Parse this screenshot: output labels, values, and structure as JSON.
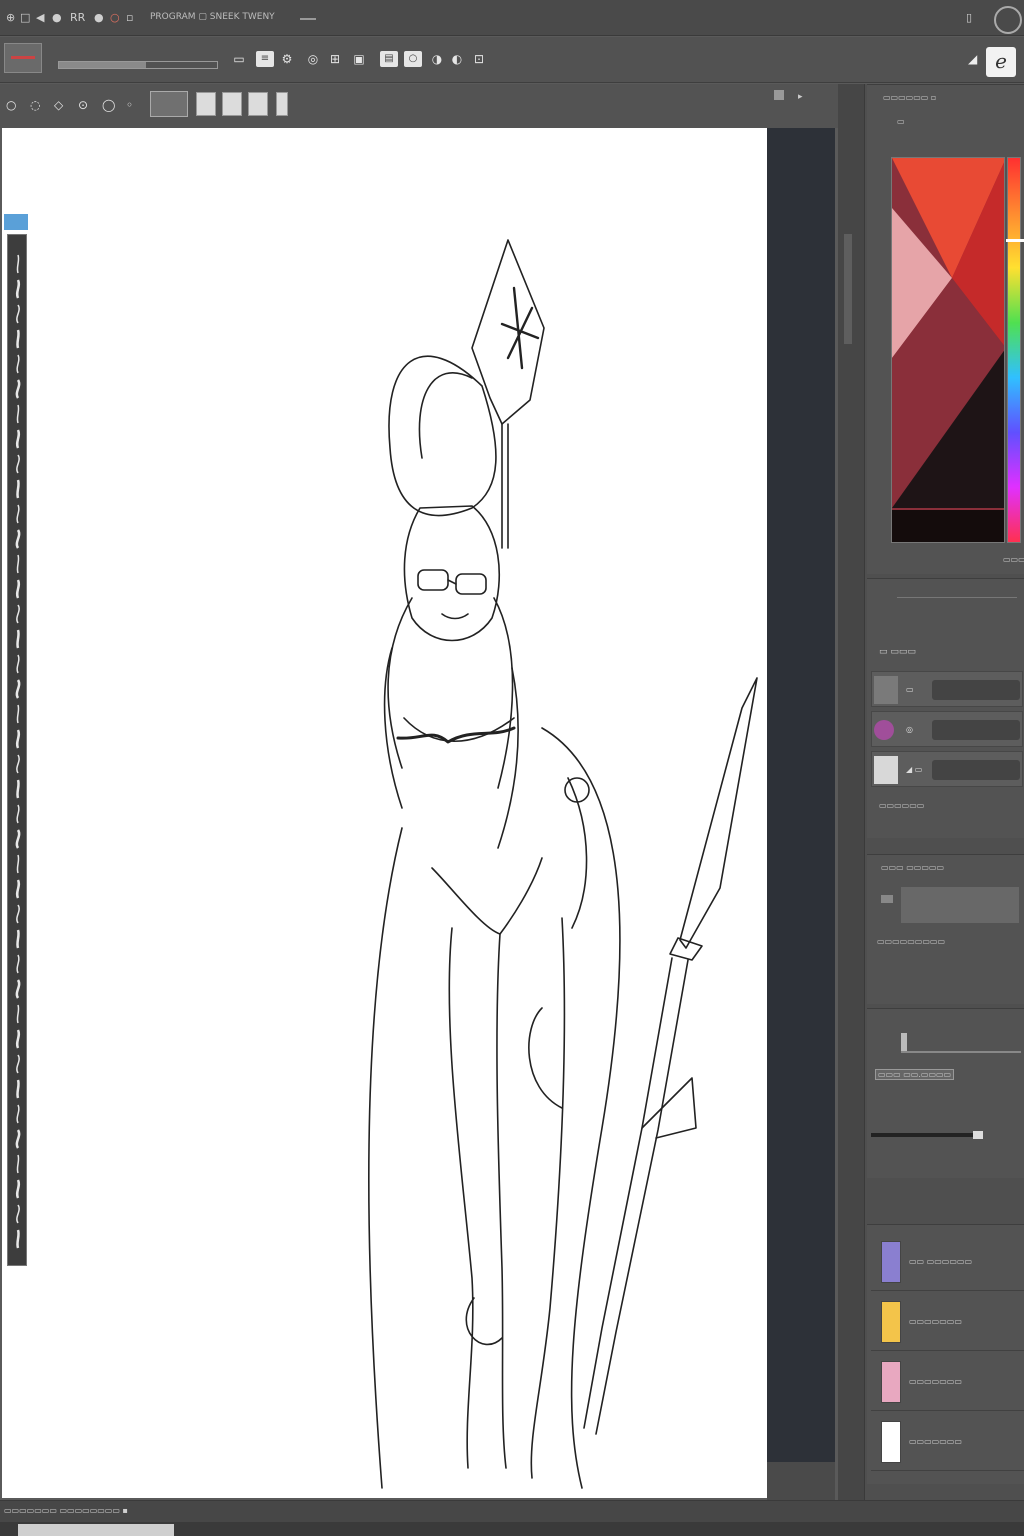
{
  "titlebar": {
    "menu_glyphs": [
      "⊕",
      "□",
      "◀",
      "●",
      "RR",
      "●",
      "○",
      "▫"
    ],
    "title": "PROGRAM ▢ SNEEK TWENY",
    "window_glyph": "▯"
  },
  "toolbar_primary": {
    "tools": [
      "▭",
      "≡",
      "⚙",
      "◎",
      "⊞",
      "▣",
      "▤",
      "○",
      "◑",
      "◐",
      "⊡"
    ],
    "file_progress": 0.55,
    "pen_icon": "◢",
    "logo": "e"
  },
  "toolbar_secondary": {
    "tools": [
      "○",
      "◌",
      "◇",
      "⊙",
      "◯",
      "◦"
    ],
    "panel_glyph": "▸"
  },
  "canvas": {
    "background": "#ffffff"
  },
  "color_panel": {
    "header": "▭▭▭▭▭▭ ▫",
    "sub": "▭",
    "gradient_top": "#e84a34",
    "gradient_mid": "#8a2f3a",
    "gradient_dark": "#1e1416",
    "hue_marker": 0.21,
    "corner_label": "▭▭▭"
  },
  "brush_panel": {
    "title": "▭ ▭▭▭",
    "layers": [
      {
        "name": "▭"
      },
      {
        "name": "◎"
      },
      {
        "name": "◢ ▭"
      }
    ],
    "layer_section_label": "▭▭▭▭▭▭",
    "sub_label_1": "▭▭▭ ▭▭▭▭▭",
    "sub_label_2": "▭▭▭▭▭▭▭▭▭",
    "opacity_label": "▭▭▭ ▭▭.▭▭▭▭"
  },
  "swatches": [
    {
      "color": "#8a7fd0",
      "label": "▭▭ ▭▭▭▭▭▭"
    },
    {
      "color": "#f3c44a",
      "label": "▭▭▭▭▭▭▭"
    },
    {
      "color": "#e8a8c0",
      "label": "▭▭▭▭▭▭▭"
    },
    {
      "color": "#ffffff",
      "label": "▭▭▭▭▭▭▭"
    }
  ],
  "statusbar": {
    "text": "▭▭▭▭▭▭▭  ▭▭▭▭▭▭▭▭ ▪"
  }
}
